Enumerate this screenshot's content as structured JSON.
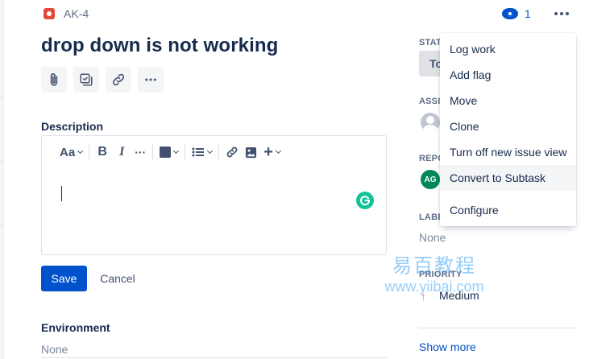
{
  "issue": {
    "key": "AK-4",
    "title": "drop down is not working",
    "watchers": "1"
  },
  "quick_actions": [
    "attach-icon",
    "subtask-icon",
    "link-icon",
    "more-icon"
  ],
  "description": {
    "label": "Description",
    "toolbar": {
      "text_style": "Aa",
      "bold": "B",
      "italic": "I",
      "more": "···",
      "text_color": "#42526e"
    }
  },
  "actions": {
    "save": "Save",
    "cancel": "Cancel"
  },
  "environment": {
    "label": "Environment",
    "value": "None"
  },
  "sidebar": {
    "status_label": "STATU",
    "status_value": "To",
    "assignee_label": "ASSIG",
    "reporter_label": "REPO",
    "reporter_initials": "AG",
    "labels_label": "LABE",
    "labels_value": "None",
    "priority_label": "PRIORITY",
    "priority_value": "Medium",
    "show_more": "Show more"
  },
  "dropdown": {
    "items": [
      "Log work",
      "Add flag",
      "Move",
      "Clone",
      "Turn off new issue view",
      "Convert to Subtask",
      "Configure"
    ]
  },
  "watermark": {
    "chinese": "易百教程",
    "url": "www.yiibai.com"
  },
  "colors": {
    "primary": "#0052cc",
    "bug": "#e5493a",
    "reporter": "#00875a",
    "grammarly": "#15c39a",
    "priority_medium": "#ff7452"
  }
}
